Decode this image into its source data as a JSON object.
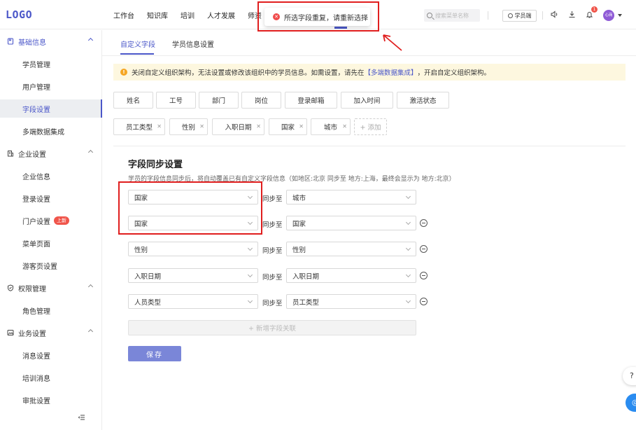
{
  "header": {
    "logo": "LOGO",
    "nav": [
      "工作台",
      "知识库",
      "培训",
      "人才发展",
      "师资"
    ],
    "search_placeholder": "搜索菜单名称",
    "student_btn": "学员端",
    "notification_count": "1",
    "avatar_text": "心商"
  },
  "toast": {
    "message": "所选字段重复，请重新选择"
  },
  "sidebar": {
    "groups": [
      {
        "label": "基础信息",
        "items": [
          "学员管理",
          "用户管理",
          "字段设置",
          "多端数据集成"
        ]
      },
      {
        "label": "企业设置",
        "items": [
          "企业信息",
          "登录设置",
          "门户设置",
          "菜单页面",
          "游客页设置"
        ]
      },
      {
        "label": "权限管理",
        "items": [
          "角色管理"
        ]
      },
      {
        "label": "业务设置",
        "items": [
          "消息设置",
          "培训消息",
          "审批设置"
        ]
      }
    ],
    "new_badge": "上新"
  },
  "tabs": [
    "自定义字段",
    "学员信息设置"
  ],
  "notice": {
    "text_before": "关闭自定义组织架构，无法设置或修改该组织中的学员信息。如需设置，请先在",
    "link": "【多端数据集成】",
    "text_after": "，开启自定义组织架构。"
  },
  "fixed_fields": [
    "姓名",
    "工号",
    "部门",
    "岗位",
    "登录邮箱",
    "加入时间",
    "激活状态"
  ],
  "custom_fields": [
    "员工类型",
    "性别",
    "入职日期",
    "国家",
    "城市"
  ],
  "add_label": "+ 添加",
  "sync": {
    "title": "字段同步设置",
    "desc": "学员的字段信息同步后，将自动覆盖已有自定义字段信息（如地区:北京 同步至 地方:上海，最终会显示为 地方:北京）",
    "sync_to": "同步至",
    "rows": [
      {
        "from": "国家",
        "to": "城市"
      },
      {
        "from": "国家",
        "to": "国家"
      },
      {
        "from": "性别",
        "to": "性别"
      },
      {
        "from": "入职日期",
        "to": "入职日期"
      },
      {
        "from": "人员类型",
        "to": "员工类型"
      }
    ],
    "add_assoc": "+  新增字段关联",
    "save": "保存"
  },
  "float": {
    "help": "?",
    "service": "◎"
  }
}
